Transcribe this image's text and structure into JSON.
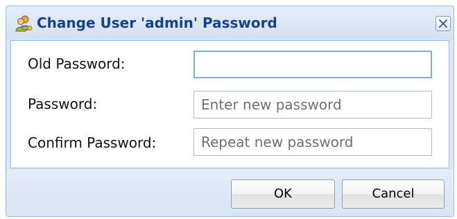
{
  "dialog": {
    "title": "Change User 'admin' Password",
    "title_icon": "users-key-icon",
    "close_icon": "close-icon"
  },
  "form": {
    "fields": [
      {
        "label": "Old Password:",
        "value": "",
        "placeholder": ""
      },
      {
        "label": "Password:",
        "value": "",
        "placeholder": "Enter new password"
      },
      {
        "label": "Confirm Password:",
        "value": "",
        "placeholder": "Repeat new password"
      }
    ]
  },
  "buttons": {
    "ok_label": "OK",
    "cancel_label": "Cancel"
  },
  "colors": {
    "title_text": "#15428b",
    "frame_border": "#99bbe8",
    "frame_background": "#dde7f4"
  }
}
